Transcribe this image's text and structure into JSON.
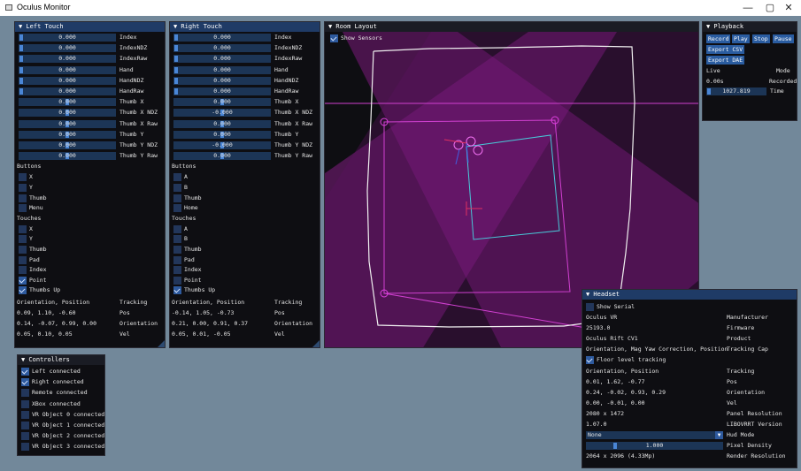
{
  "app": {
    "title": "Oculus Monitor",
    "minimize": "—",
    "maximize": "▢",
    "close": "✕"
  },
  "left_touch": {
    "title": "▼ Left Touch",
    "sliders": [
      {
        "value": "0.000",
        "label": "Index",
        "fill": 0
      },
      {
        "value": "0.000",
        "label": "IndexNDZ",
        "fill": 0
      },
      {
        "value": "0.000",
        "label": "IndexRaw",
        "fill": 0
      },
      {
        "value": "0.000",
        "label": "Hand",
        "fill": 0
      },
      {
        "value": "0.000",
        "label": "HandNDZ",
        "fill": 0
      },
      {
        "value": "0.000",
        "label": "HandRaw",
        "fill": 0
      },
      {
        "value": "0.000",
        "label": "Thumb X",
        "fill": 0.5
      },
      {
        "value": "0.000",
        "label": "Thumb X NDZ",
        "fill": 0.5
      },
      {
        "value": "0.000",
        "label": "Thumb X Raw",
        "fill": 0.5
      },
      {
        "value": "0.000",
        "label": "Thumb Y",
        "fill": 0.5
      },
      {
        "value": "0.000",
        "label": "Thumb Y NDZ",
        "fill": 0.5
      },
      {
        "value": "0.000",
        "label": "Thumb Y Raw",
        "fill": 0.5
      }
    ],
    "buttons_header": "Buttons",
    "buttons": [
      {
        "label": "X",
        "checked": false
      },
      {
        "label": "Y",
        "checked": false
      },
      {
        "label": "Thumb",
        "checked": false
      },
      {
        "label": "Menu",
        "checked": false
      }
    ],
    "touches_header": "Touches",
    "touches": [
      {
        "label": "X",
        "checked": false
      },
      {
        "label": "Y",
        "checked": false
      },
      {
        "label": "Thumb",
        "checked": false
      },
      {
        "label": "Pad",
        "checked": false
      },
      {
        "label": "Index",
        "checked": false
      },
      {
        "label": "Point",
        "checked": true
      },
      {
        "label": "Thumbs Up",
        "checked": true
      }
    ],
    "tracking_rows": [
      {
        "value": "Orientation, Position",
        "label": "Tracking"
      },
      {
        "value": "0.09, 1.10, -0.60",
        "label": "Pos"
      },
      {
        "value": "0.14, -0.07, 0.99, 0.00",
        "label": "Orientation"
      },
      {
        "value": "0.05, 0.10, 0.05",
        "label": "Vel"
      }
    ]
  },
  "right_touch": {
    "title": "▼ Right Touch",
    "sliders": [
      {
        "value": "0.000",
        "label": "Index",
        "fill": 0
      },
      {
        "value": "0.000",
        "label": "IndexNDZ",
        "fill": 0
      },
      {
        "value": "0.000",
        "label": "IndexRaw",
        "fill": 0
      },
      {
        "value": "0.000",
        "label": "Hand",
        "fill": 0
      },
      {
        "value": "0.000",
        "label": "HandNDZ",
        "fill": 0
      },
      {
        "value": "0.000",
        "label": "HandRaw",
        "fill": 0
      },
      {
        "value": "0.000",
        "label": "Thumb X",
        "fill": 0.5
      },
      {
        "value": "-0.000",
        "label": "Thumb X NDZ",
        "fill": 0.5
      },
      {
        "value": "0.000",
        "label": "Thumb X Raw",
        "fill": 0.5
      },
      {
        "value": "0.000",
        "label": "Thumb Y",
        "fill": 0.5
      },
      {
        "value": "-0.000",
        "label": "Thumb Y NDZ",
        "fill": 0.5
      },
      {
        "value": "0.000",
        "label": "Thumb Y Raw",
        "fill": 0.5
      }
    ],
    "buttons_header": "Buttons",
    "buttons": [
      {
        "label": "A",
        "checked": false
      },
      {
        "label": "B",
        "checked": false
      },
      {
        "label": "Thumb",
        "checked": false
      },
      {
        "label": "Home",
        "checked": false
      }
    ],
    "touches_header": "Touches",
    "touches": [
      {
        "label": "A",
        "checked": false
      },
      {
        "label": "B",
        "checked": false
      },
      {
        "label": "Thumb",
        "checked": false
      },
      {
        "label": "Pad",
        "checked": false
      },
      {
        "label": "Index",
        "checked": false
      },
      {
        "label": "Point",
        "checked": false
      },
      {
        "label": "Thumbs Up",
        "checked": true
      }
    ],
    "tracking_rows": [
      {
        "value": "Orientation, Position",
        "label": "Tracking"
      },
      {
        "value": "-0.14, 1.05, -0.73",
        "label": "Pos"
      },
      {
        "value": "0.21, 0.00, 0.91, 0.37",
        "label": "Orientation"
      },
      {
        "value": "0.05, 0.01, -0.05",
        "label": "Vel"
      }
    ]
  },
  "room_layout": {
    "title": "▼ Room Layout",
    "show_sensors_label": "Show Sensors",
    "show_sensors": true
  },
  "playback": {
    "title": "▼ Playback",
    "buttons": [
      "Record",
      "Play",
      "Stop",
      "Pause"
    ],
    "export_csv": "Export CSV",
    "export_dae": "Export DAE",
    "live_label": "Live",
    "mode_label": "Mode",
    "time_value": "0.00s",
    "recorded_label": "Recorded",
    "slider_value": "1027.819",
    "slider_fill": 0.0,
    "time_label": "Time"
  },
  "controllers": {
    "title": "▼ Controllers",
    "items": [
      {
        "label": "Left connected",
        "checked": true
      },
      {
        "label": "Right connected",
        "checked": true
      },
      {
        "label": "Remote connected",
        "checked": false
      },
      {
        "label": "XBox connected",
        "checked": false
      },
      {
        "label": "VR Object 0 connected",
        "checked": false
      },
      {
        "label": "VR Object 1 connected",
        "checked": false
      },
      {
        "label": "VR Object 2 connected",
        "checked": false
      },
      {
        "label": "VR Object 3 connected",
        "checked": false
      }
    ]
  },
  "headset": {
    "title": "▼ Headset",
    "show_serial_label": "Show Serial",
    "show_serial": false,
    "rows1": [
      {
        "value": "Oculus VR",
        "label": "Manufacturer"
      },
      {
        "value": "25193.0",
        "label": "Firmware"
      },
      {
        "value": "Oculus Rift CV1",
        "label": "Product"
      },
      {
        "value": "Orientation, Mag Yaw Correction, Position",
        "label": "Tracking Cap"
      }
    ],
    "floor_label": "Floor level tracking",
    "floor_checked": true,
    "rows2": [
      {
        "value": "Orientation, Position",
        "label": "Tracking"
      },
      {
        "value": "0.01, 1.62, -0.77",
        "label": "Pos"
      },
      {
        "value": "0.24, -0.02, 0.93, 0.29",
        "label": "Orientation"
      },
      {
        "value": "0.00, -0.01, 0.00",
        "label": "Vel"
      },
      {
        "value": "2080 x 1472",
        "label": "Panel Resolution"
      },
      {
        "value": "1.07.0",
        "label": "LIBOVRRT Version"
      }
    ],
    "hud_value": "None",
    "hud_label": "Hud Mode",
    "pixel_density_value": "1.000",
    "pixel_density_fill": 0.2,
    "pixel_density_label": "Pixel Density",
    "render_res_value": "2064 x 2096  (4.33Mp)",
    "render_res_label": "Render Resolution"
  }
}
